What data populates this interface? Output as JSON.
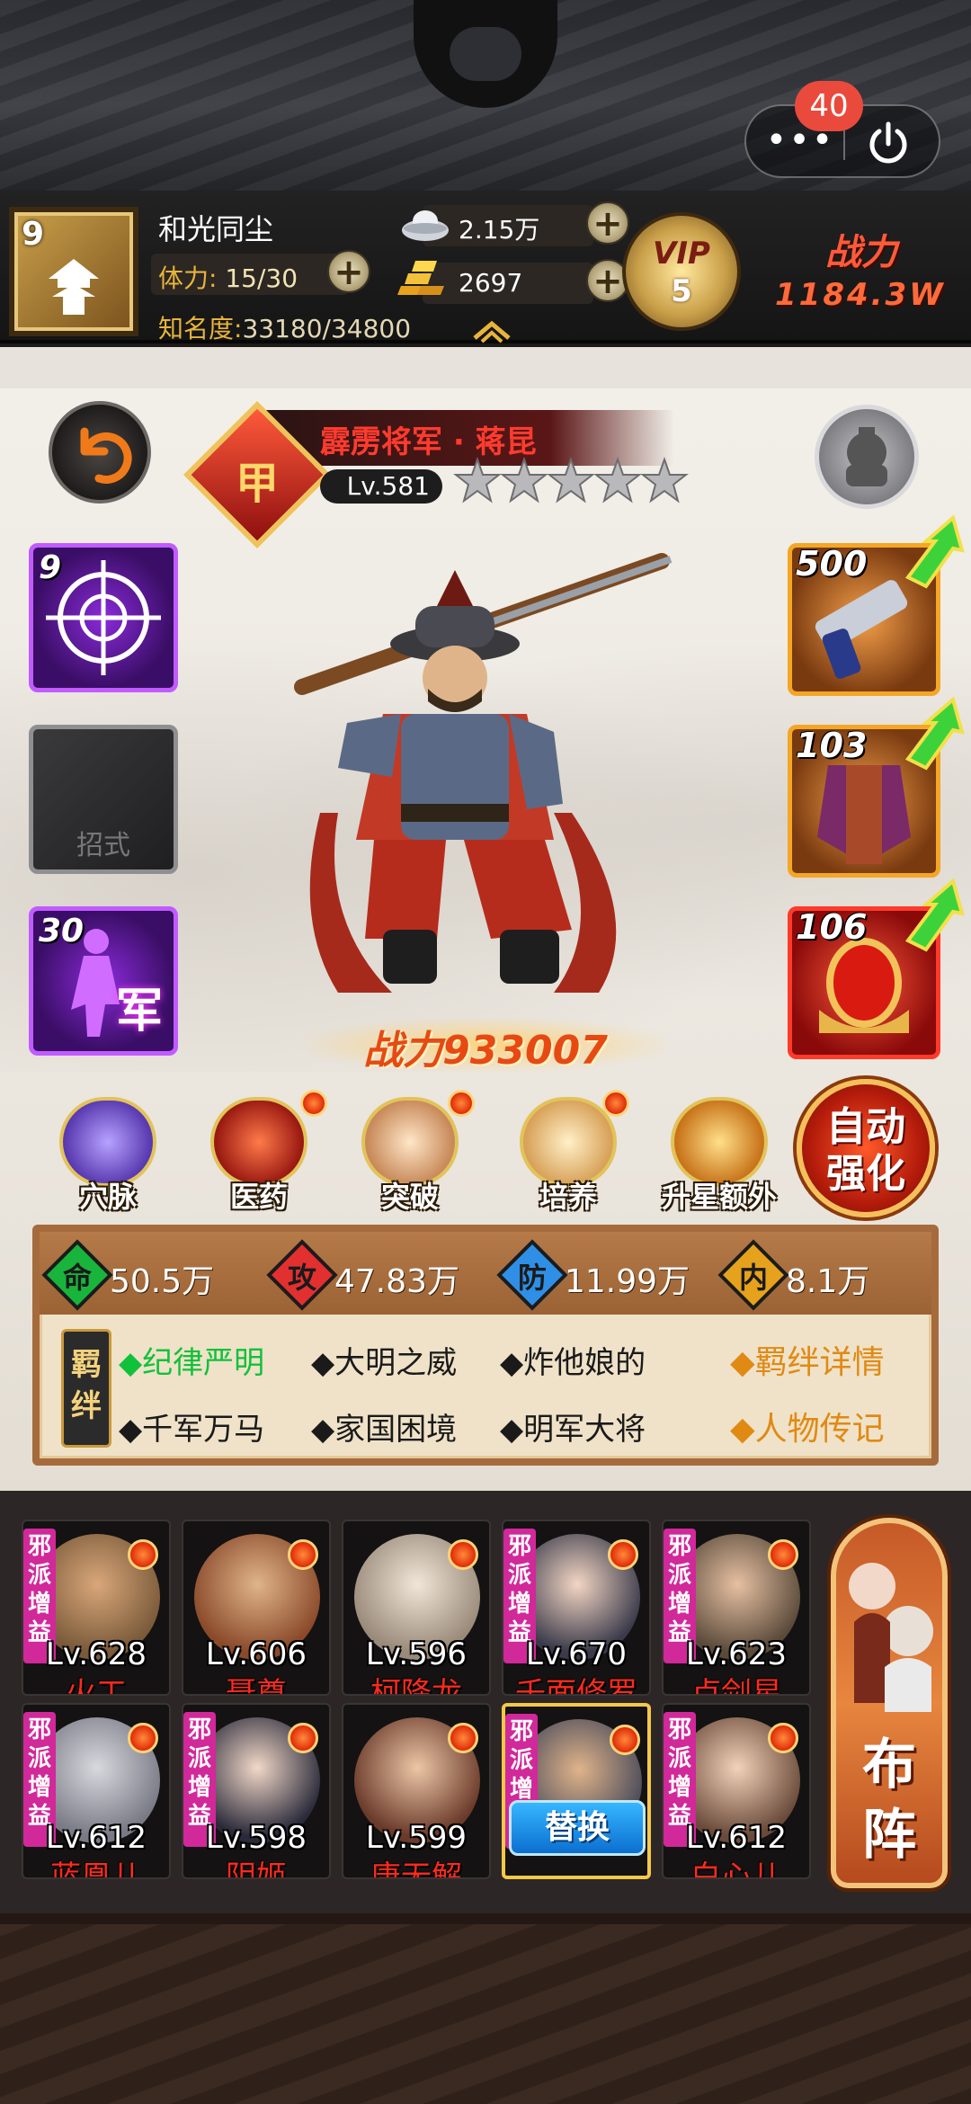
{
  "capsule": {
    "more_label": "•••",
    "badge_count": "40"
  },
  "player": {
    "level": "9",
    "name": "和光同尘",
    "stamina_label": "体力:",
    "stamina_value": "15/30",
    "fame_label": "知名度:",
    "fame_value": "33180/34800"
  },
  "currency": {
    "silver": "2.15万",
    "gold": "2697"
  },
  "vip": {
    "label": "VIP",
    "level": "5"
  },
  "top_power": {
    "label": "战力",
    "value": "1184.3W"
  },
  "hero": {
    "grade": "甲",
    "title": "霹雳将军 · 蒋昆",
    "level": "Lv.581",
    "stars": 5,
    "power_label": "战力",
    "power_value": "933007"
  },
  "skills": [
    {
      "level": "9",
      "label": ""
    },
    {
      "level": "",
      "label": "招式"
    },
    {
      "level": "30",
      "label": "军"
    }
  ],
  "equipment": [
    {
      "level": "500"
    },
    {
      "level": "103"
    },
    {
      "level": "106"
    }
  ],
  "functions": [
    {
      "label": "穴脉",
      "dot": false
    },
    {
      "label": "医药",
      "dot": true
    },
    {
      "label": "突破",
      "dot": true
    },
    {
      "label": "培养",
      "dot": true
    },
    {
      "label": "升星额外",
      "dot": false
    }
  ],
  "auto_strengthen": {
    "line1": "自动",
    "line2": "强化"
  },
  "stats": [
    {
      "icon": "命",
      "value": "50.5万",
      "color": "#19b43c"
    },
    {
      "icon": "攻",
      "value": "47.83万",
      "color": "#e23030"
    },
    {
      "icon": "防",
      "value": "11.99万",
      "color": "#2f8fe6"
    },
    {
      "icon": "内",
      "value": "8.1万",
      "color": "#e6a21c"
    }
  ],
  "bond_seal": {
    "line1": "羁",
    "line2": "绊"
  },
  "bonds": [
    {
      "text": "◆纪律严明",
      "active": true
    },
    {
      "text": "◆大明之威",
      "active": false
    },
    {
      "text": "◆炸他娘的",
      "active": false
    },
    {
      "text": "◆千军万马",
      "active": false
    },
    {
      "text": "◆家国困境",
      "active": false
    },
    {
      "text": "◆明军大将",
      "active": false
    }
  ],
  "links": {
    "bond_detail": "◆羁绊详情",
    "biography": "◆人物传记"
  },
  "lineup": [
    {
      "level": "Lv.628",
      "name": "火工",
      "evil": true,
      "color": "#7a5a3a"
    },
    {
      "level": "Lv.606",
      "name": "聂尊",
      "evil": false,
      "color": "#8a4a2a"
    },
    {
      "level": "Lv.596",
      "name": "柯降龙",
      "evil": false,
      "color": "#9a8a7a"
    },
    {
      "level": "Lv.670",
      "name": "千面修罗",
      "evil": true,
      "color": "#3a3a4a"
    },
    {
      "level": "Lv.623",
      "name": "卢剑星",
      "evil": true,
      "color": "#5a4a3a"
    },
    {
      "level": "Lv.612",
      "name": "蓝凰儿",
      "evil": true,
      "color": "#7a7a86"
    },
    {
      "level": "Lv.598",
      "name": "阴姬",
      "evil": true,
      "color": "#2a2a3a"
    },
    {
      "level": "Lv.599",
      "name": "唐无解",
      "evil": false,
      "color": "#6a3a2a"
    },
    {
      "level": "",
      "name": "",
      "evil": true,
      "color": "#4a4a5a"
    },
    {
      "level": "Lv.612",
      "name": "白心儿",
      "evil": true,
      "color": "#6a4a3a"
    }
  ],
  "evil_tag": "邪派增益",
  "replace_label": "替换",
  "formation": {
    "line1": "布",
    "line2": "阵"
  }
}
